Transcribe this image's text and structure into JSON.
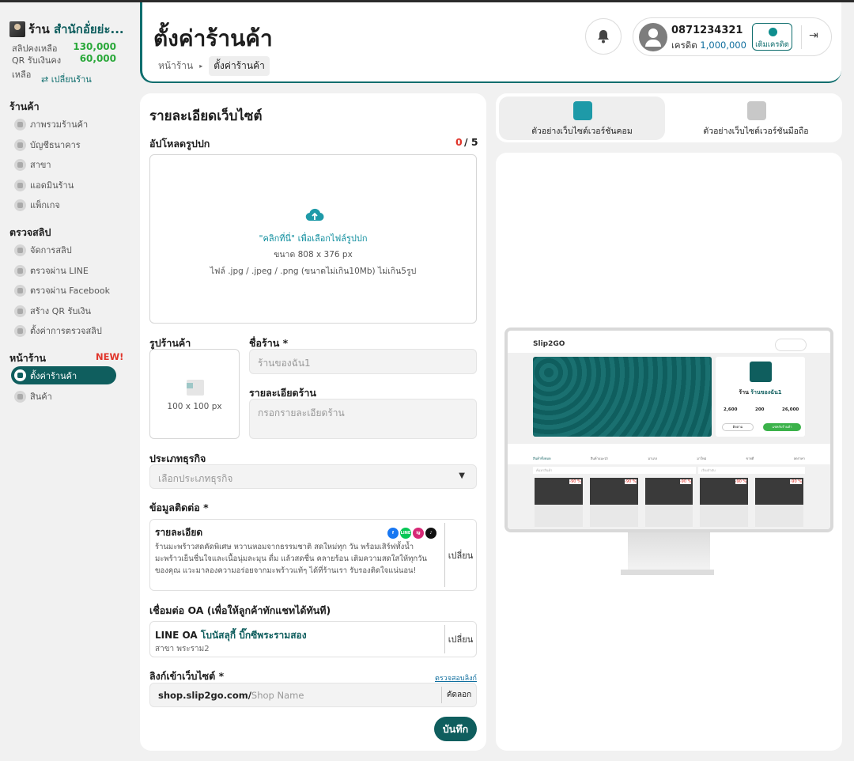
{
  "sidebar": {
    "shop_prefix": "ร้าน",
    "shop_name": "สำนักอั่ยย่ะ...",
    "slip_label": "สลิปคงเหลือ",
    "slip_value": "130,000",
    "qr_label": "QR รับเงินคงเหลือ",
    "qr_value": "60,000",
    "change_shop": "⇄ เปลี่ยนร้าน",
    "section_shop": "ร้านค้า",
    "shop_items": [
      "ภาพรวมร้านค้า",
      "บัญชีธนาคาร",
      "สาขา",
      "แอดมินร้าน",
      "แพ็กเกจ"
    ],
    "section_check": "ตรวจสลิป",
    "check_items": [
      "จัดการสลิป",
      "ตรวจผ่าน LINE",
      "ตรวจผ่าน Facebook",
      "สร้าง QR รับเงิน",
      "ตั้งค่าการตรวจสลิป"
    ],
    "section_store": "หน้าร้าน",
    "new_badge": "NEW!",
    "store_items": [
      "ตั้งค่าร้านค้า",
      "สินค้า"
    ]
  },
  "header": {
    "title": "ตั้งค่าร้านค้า",
    "breadcrumb_home": "หน้าร้าน",
    "breadcrumb_current": "ตั้งค่าร้านค้า",
    "phone": "0871234321",
    "credit_label": "เครดิต",
    "credit_value": "1,000,000",
    "topup_label": "เติมเครดิต"
  },
  "form": {
    "section_title": "รายละเอียดเว็บไซต์",
    "cover_label": "อัปโหลดรูปปก",
    "cover_count": "0",
    "cover_max": "/ 5",
    "upload_hint": "\"คลิกที่นี่\" เพื่อเลือกไฟล์รูปปก",
    "upload_size": "ขนาด 808 x 376 px",
    "upload_types": "ไฟล์ .jpg / .jpeg / .png (ขนาดไม่เกิน10Mb) ไม่เกิน5รูป",
    "shop_image_label": "รูปร้านค้า",
    "shop_image_size": "100 x 100 px",
    "shop_name_label": "ชื่อร้าน *",
    "shop_name_placeholder": "ร้านของฉัน1",
    "shop_desc_label": "รายละเอียดร้าน",
    "shop_desc_placeholder": "กรอกรายละเอียดร้าน",
    "business_label": "ประเภทธุรกิจ",
    "business_placeholder": "เลือกประเภทธุรกิจ",
    "contact_label": "ข้อมูลติดต่อ *",
    "contact_title": "รายละเอียด",
    "contact_text": "ร้านมะพร้าวสดคัดพิเศษ หวานหอมจากธรรมชาติ สดใหม่ทุก วัน พร้อมเสิร์ฟทั้งน้ำมะพร้าวเย็นชื่นใจและเนื้อนุ่มละมุน ดื่ม แล้วสดชื่น คลายร้อน เติมความสดใสให้ทุกวันของคุณ แวะมาลองความอร่อยจากมะพร้าวแท้ๆ ได้ที่ร้านเรา รับรองติดใจแน่นอน!",
    "change_label": "เปลี่ยน",
    "oa_label": "เชื่อมต่อ OA (เพื่อให้ลูกค้าทักแชทได้ทันที)",
    "oa_prefix": "LINE OA",
    "oa_name": "โบนัสลุกี้ บิ๊กซีพระรามสอง",
    "oa_branch": "สาขา พระราม2",
    "link_label": "ลิงก์เข้าเว็บไซต์ *",
    "check_link": "ตรวจสอบลิงก์",
    "link_domain": "shop.slip2go.com/",
    "link_placeholder": "Shop Name",
    "copy_label": "คัดลอก",
    "save_label": "บันทึก"
  },
  "preview": {
    "tab_desktop": "ตัวอย่างเว็บไซต์เวอร์ชันคอม",
    "tab_mobile": "ตัวอย่างเว็บไซต์เวอร์ชันมือถือ",
    "logo": "Slip2GO",
    "shop_prefix": "ร้าน",
    "shop_name": "ร้านของฉัน1",
    "stats": [
      {
        "value": "2,600",
        "label": "ผู้ติดตาม"
      },
      {
        "value": "200",
        "label": "สินค้า"
      },
      {
        "value": "26,000",
        "label": "ขายแล้วทั้งหมด"
      }
    ],
    "btn_follow": "ติดตาม",
    "btn_chat": "แชทกับร้านค้า",
    "categories": [
      "สินค้าทั้งหมด",
      "สินค้าแนะนำ",
      "มาแรง",
      "มาใหม่",
      "ขายดี",
      "ลดราคา"
    ],
    "search_placeholder": "ค้นหาสินค้า",
    "search_btn": "ค้นหา",
    "sort_placeholder": "เรียงลำดับ",
    "discount": "-90 %"
  },
  "colors": {
    "brand": "#0f5e5e",
    "accent": "#2aa83a",
    "danger": "#e0352b"
  }
}
